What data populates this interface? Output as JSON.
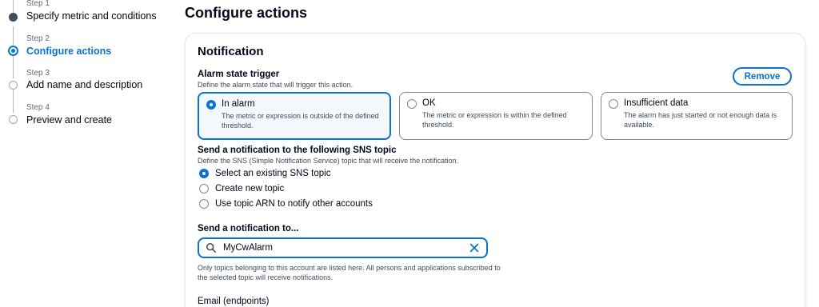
{
  "steps": [
    {
      "num": "Step 1",
      "title": "Specify metric and conditions",
      "state": "done"
    },
    {
      "num": "Step 2",
      "title": "Configure actions",
      "state": "active"
    },
    {
      "num": "Step 3",
      "title": "Add name and description",
      "state": "todo"
    },
    {
      "num": "Step 4",
      "title": "Preview and create",
      "state": "todo"
    }
  ],
  "page_title": "Configure actions",
  "notification": {
    "heading": "Notification",
    "remove_label": "Remove",
    "alarm_trigger": {
      "title": "Alarm state trigger",
      "description": "Define the alarm state that will trigger this action.",
      "options": [
        {
          "label": "In alarm",
          "description": "The metric or expression is outside of the defined threshold.",
          "selected": true
        },
        {
          "label": "OK",
          "description": "The metric or expression is within the defined threshold.",
          "selected": false
        },
        {
          "label": "Insufficient data",
          "description": "The alarm has just started or not enough data is available.",
          "selected": false
        }
      ]
    },
    "sns": {
      "title": "Send a notification to the following SNS topic",
      "description": "Define the SNS (Simple Notification Service) topic that will receive the notification.",
      "options": [
        {
          "label": "Select an existing SNS topic",
          "selected": true
        },
        {
          "label": "Create new topic",
          "selected": false
        },
        {
          "label": "Use topic ARN to notify other accounts",
          "selected": false
        }
      ]
    },
    "send_to": {
      "title": "Send a notification to...",
      "value": "MyCwAlarm",
      "hint": "Only topics belonging to this account are listed here. All persons and applications subscribed to the selected topic will receive notifications."
    },
    "email_label": "Email (endpoints)"
  },
  "colors": {
    "accent": "#0972d3",
    "text": "#000716",
    "muted": "#414d5c"
  }
}
